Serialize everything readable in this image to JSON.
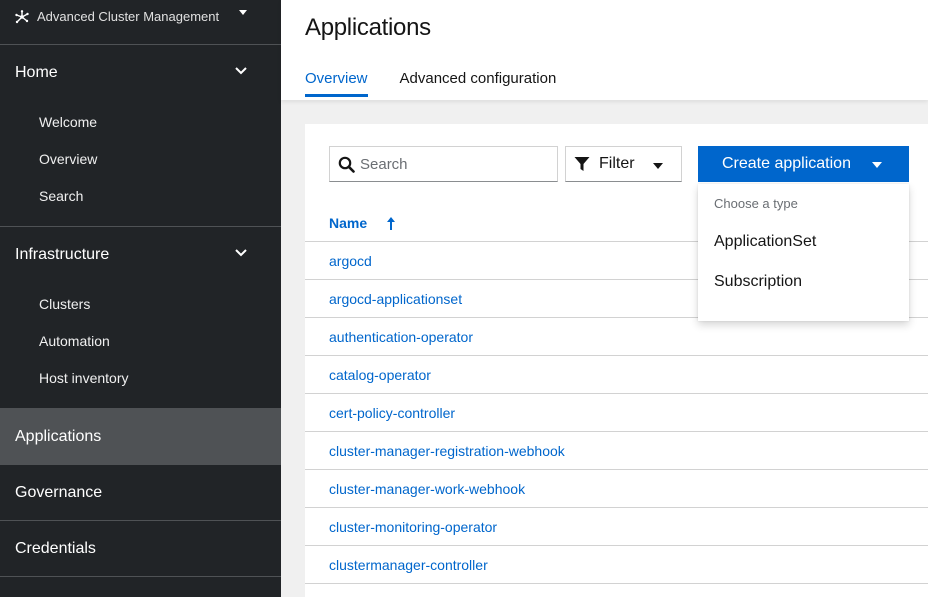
{
  "switcher": {
    "title": "Advanced Cluster Management",
    "icon": "cluster-management-icon"
  },
  "sidebar": {
    "home": {
      "label": "Home",
      "items": [
        "Welcome",
        "Overview",
        "Search"
      ]
    },
    "infrastructure": {
      "label": "Infrastructure",
      "items": [
        "Clusters",
        "Automation",
        "Host inventory"
      ]
    },
    "applications": "Applications",
    "governance": "Governance",
    "credentials": "Credentials"
  },
  "page": {
    "title": "Applications",
    "tabs": [
      "Overview",
      "Advanced configuration"
    ]
  },
  "toolbar": {
    "search_placeholder": "Search",
    "filter_label": "Filter",
    "create_label": "Create application"
  },
  "table": {
    "column_name": "Name",
    "sort": "ascending",
    "rows": [
      "argocd",
      "argocd-applicationset",
      "authentication-operator",
      "catalog-operator",
      "cert-policy-controller",
      "cluster-manager-registration-webhook",
      "cluster-manager-work-webhook",
      "cluster-monitoring-operator",
      "clustermanager-controller"
    ]
  },
  "create_menu": {
    "group_label": "Choose a type",
    "items": [
      "ApplicationSet",
      "Subscription"
    ]
  },
  "colors": {
    "accent": "#0066cc",
    "sidebar_bg": "#212427",
    "active_bg": "#4f5255"
  }
}
